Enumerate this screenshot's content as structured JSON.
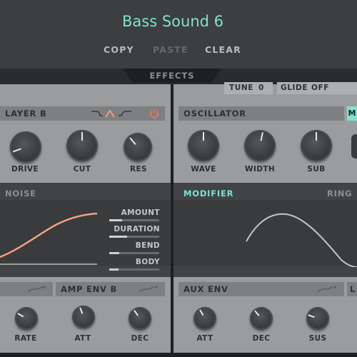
{
  "header": {
    "title": "Bass Sound 6",
    "copy_label": "COPY",
    "paste_label": "PASTE",
    "clear_label": "CLEAR",
    "effects_label": "EFFECTS"
  },
  "colors": {
    "accent": "#7de3cf",
    "power": "#e8755a",
    "curve": "#f0a184"
  },
  "left": {
    "layer_title": "LAYER B",
    "knobs": [
      {
        "label": "DRIVE",
        "value": 0.15
      },
      {
        "label": "CUT",
        "value": 0.5
      },
      {
        "label": "RES",
        "value": 0.3
      }
    ],
    "noise_title": "NOISE",
    "params": [
      {
        "label": "AMOUNT",
        "value": 0.25
      },
      {
        "label": "DURATION",
        "value": 0.35
      },
      {
        "label": "BEND",
        "value": 0.2
      },
      {
        "label": "BODY",
        "value": 0.18
      }
    ],
    "amp_env_title": "AMP ENV B",
    "bottom_knobs": [
      {
        "label": "RATE",
        "value": 0.3
      },
      {
        "label": "ATT",
        "value": 0.45
      },
      {
        "label": "DEC",
        "value": 0.4
      }
    ]
  },
  "right": {
    "tune_label": "TUNE",
    "tune_value": "0",
    "glide_label": "GLIDE",
    "glide_value": "OFF",
    "oscillator_title": "OSCILLATOR",
    "mono_badge": "M",
    "knobs": [
      {
        "label": "WAVE",
        "value": 0.5
      },
      {
        "label": "WIDTH",
        "value": 0.55
      },
      {
        "label": "SUB",
        "value": 0.5
      }
    ],
    "modifier_title": "MODIFIER",
    "ring_label": "RING",
    "aux_env_title": "AUX ENV",
    "aux_tab_letter": "L",
    "bottom_knobs": [
      {
        "label": "ATT",
        "value": 0.45
      },
      {
        "label": "DEC",
        "value": 0.42
      },
      {
        "label": "SUS",
        "value": 0.3
      }
    ]
  }
}
